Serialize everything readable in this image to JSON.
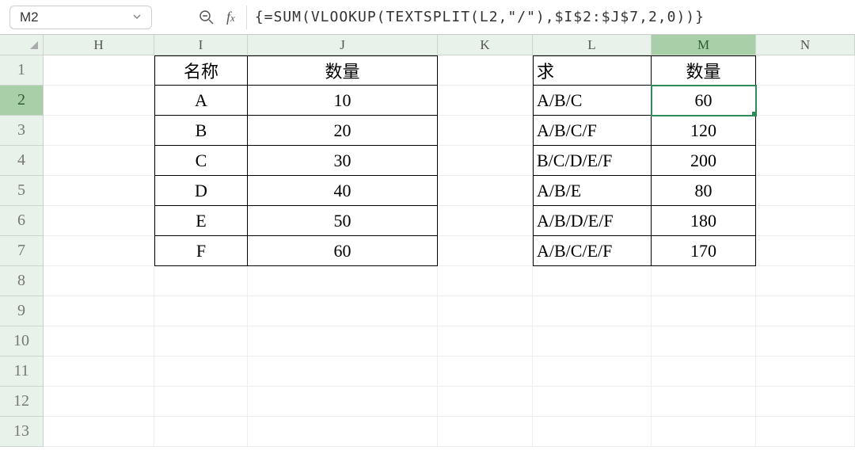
{
  "name_box": "M2",
  "formula": "{=SUM(VLOOKUP(TEXTSPLIT(L2,\"/\"),$I$2:$J$7,2,0))}",
  "columns": [
    "H",
    "I",
    "J",
    "K",
    "L",
    "M",
    "N"
  ],
  "active_column": "M",
  "active_row": "2",
  "row_numbers": [
    "1",
    "2",
    "3",
    "4",
    "5",
    "6",
    "7",
    "8",
    "9",
    "10",
    "11",
    "12",
    "13"
  ],
  "table1": {
    "headers": {
      "name": "名称",
      "qty": "数量"
    },
    "rows": [
      {
        "name": "A",
        "qty": "10"
      },
      {
        "name": "B",
        "qty": "20"
      },
      {
        "name": "C",
        "qty": "30"
      },
      {
        "name": "D",
        "qty": "40"
      },
      {
        "name": "E",
        "qty": "50"
      },
      {
        "name": "F",
        "qty": "60"
      }
    ]
  },
  "table2": {
    "headers": {
      "req": "求",
      "qty": "数量"
    },
    "rows": [
      {
        "req": "A/B/C",
        "qty": "60"
      },
      {
        "req": "A/B/C/F",
        "qty": "120"
      },
      {
        "req": "B/C/D/E/F",
        "qty": "200"
      },
      {
        "req": "A/B/E",
        "qty": "80"
      },
      {
        "req": "A/B/D/E/F",
        "qty": "180"
      },
      {
        "req": "A/B/C/E/F",
        "qty": "170"
      }
    ]
  }
}
